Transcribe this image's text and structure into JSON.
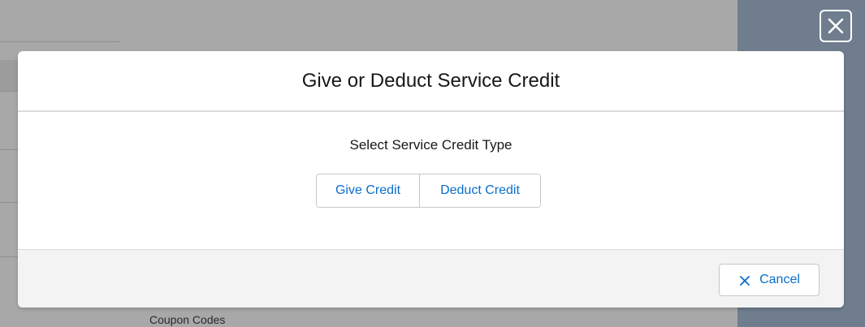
{
  "background": {
    "coupon_codes_label": "Coupon Codes"
  },
  "overlay": {
    "close_icon": "close-icon"
  },
  "modal": {
    "title": "Give or Deduct Service Credit",
    "body": {
      "label": "Select Service Credit Type",
      "options": [
        {
          "label": "Give Credit"
        },
        {
          "label": "Deduct Credit"
        }
      ]
    },
    "footer": {
      "cancel_label": "Cancel",
      "cancel_icon": "close-icon"
    }
  },
  "colors": {
    "accent": "#0a6ecb",
    "overlay_gray": "#a8a8a8",
    "right_panel": "#6f7d8f",
    "border": "#c9c7c5",
    "footer_bg": "#f3f3f3"
  }
}
